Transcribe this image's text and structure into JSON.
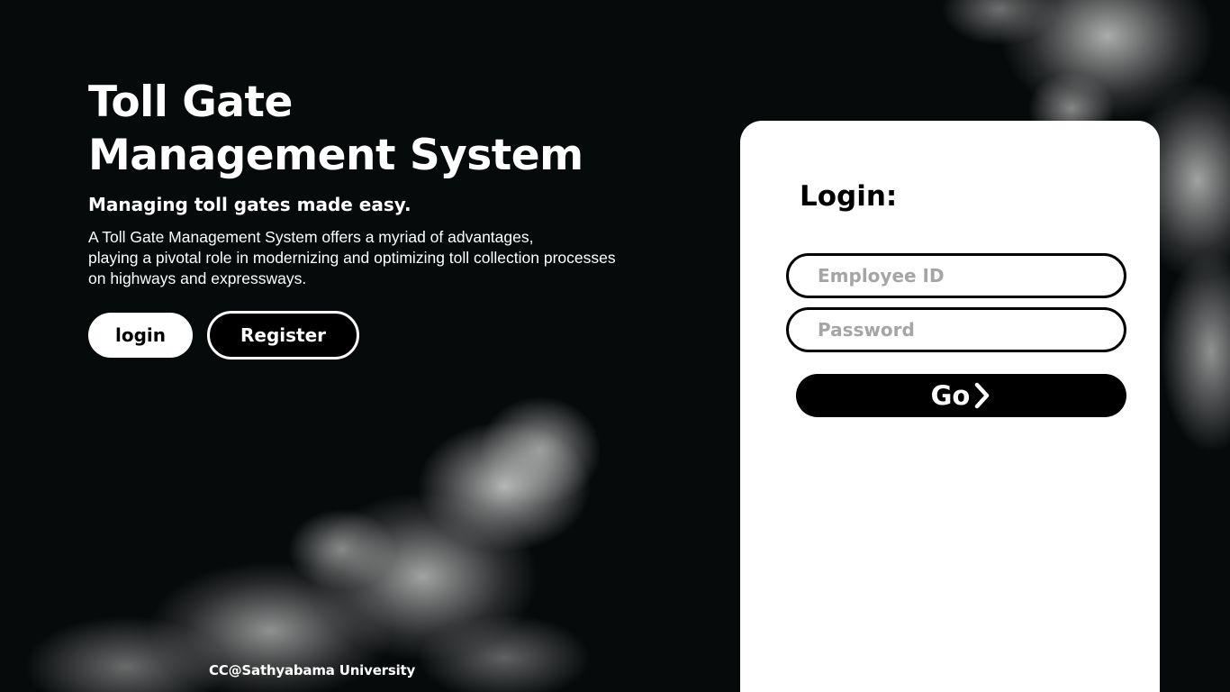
{
  "hero": {
    "title_line1": "Toll Gate",
    "title_line2": "Management System",
    "subtitle": "Managing toll gates made easy.",
    "description_line1": "A Toll Gate Management System offers a myriad of advantages,",
    "description_line2": "playing a pivotal role in modernizing and optimizing toll collection processes",
    "description_line3": "on highways and expressways.",
    "login_button": "login",
    "register_button": "Register"
  },
  "login_form": {
    "heading": "Login:",
    "employee_id_placeholder": "Employee ID",
    "employee_id_value": "",
    "password_placeholder": "Password",
    "password_value": "",
    "submit_label": "Go",
    "submit_icon": "chevron-right-icon"
  },
  "footer": {
    "credit": "CC@Sathyabama University"
  },
  "colors": {
    "background": "#070a0b",
    "card": "#ffffff",
    "accent": "#000000",
    "placeholder": "#a5a5a5"
  }
}
